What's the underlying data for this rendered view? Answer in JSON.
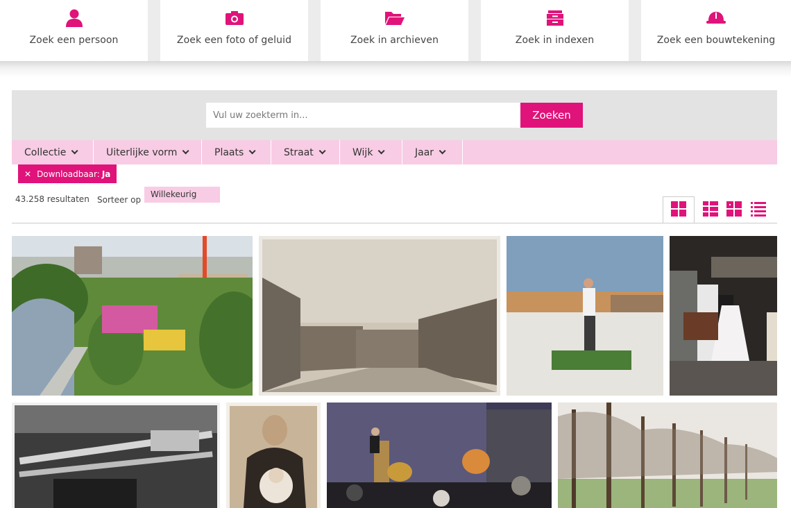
{
  "nav": {
    "tiles": [
      {
        "label": "Zoek een persoon",
        "icon": "person-icon"
      },
      {
        "label": "Zoek een foto of geluid",
        "icon": "camera-icon"
      },
      {
        "label": "Zoek in archieven",
        "icon": "folder-open-icon"
      },
      {
        "label": "Zoek in indexen",
        "icon": "archive-box-icon"
      },
      {
        "label": "Zoek een bouwtekening",
        "icon": "hard-hat-icon"
      }
    ]
  },
  "search": {
    "placeholder": "Vul uw zoekterm in...",
    "button_label": "Zoeken"
  },
  "filters": [
    {
      "label": "Collectie"
    },
    {
      "label": "Uiterlijke vorm"
    },
    {
      "label": "Plaats"
    },
    {
      "label": "Straat"
    },
    {
      "label": "Wijk"
    },
    {
      "label": "Jaar"
    }
  ],
  "active_filter": {
    "name": "Downloadbaar:",
    "value": "Ja"
  },
  "results": {
    "count": "43.258 resultaten",
    "sort_label": "Sorteer op",
    "sort_value": "Willekeurig"
  },
  "views": [
    {
      "icon": "grid-large-icon",
      "active": true
    },
    {
      "icon": "grid-list-icon",
      "active": false
    },
    {
      "icon": "grid-small-icon",
      "active": false
    },
    {
      "icon": "list-icon",
      "active": false
    }
  ],
  "colors": {
    "accent": "#e0137a",
    "accent_light": "#f8cce4",
    "panel": "#e3e3e3"
  },
  "photos": [
    {
      "subject": "fairground-aerial-photo"
    },
    {
      "subject": "sepia-street-houses-photo"
    },
    {
      "subject": "golfer-on-mat-photo"
    },
    {
      "subject": "wedding-couple-photo"
    },
    {
      "subject": "workshop-machinery-photo"
    },
    {
      "subject": "woman-with-baby-portrait-photo"
    },
    {
      "subject": "stage-speaker-photo"
    },
    {
      "subject": "tree-lane-photo"
    }
  ]
}
